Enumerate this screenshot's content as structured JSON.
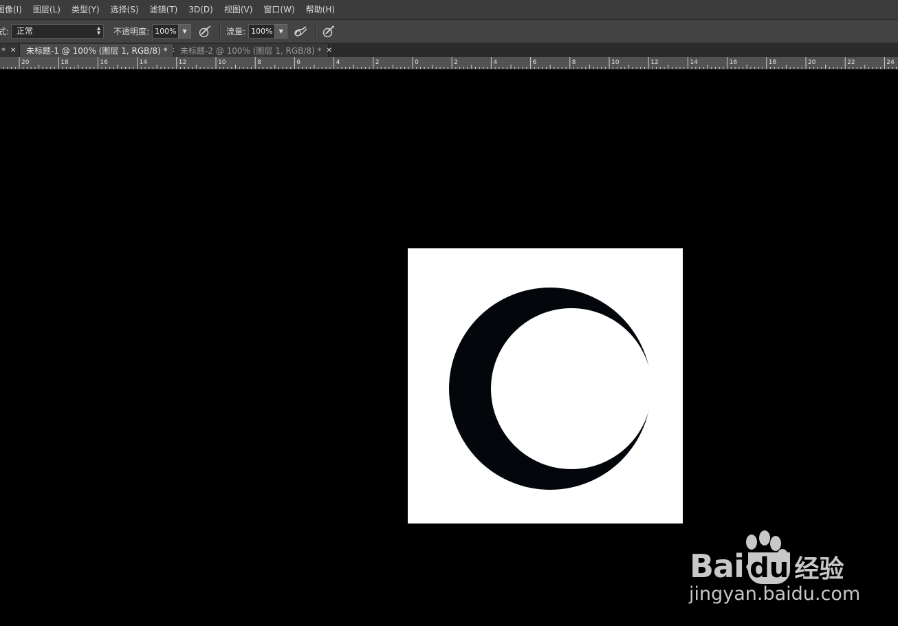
{
  "menu": {
    "items": [
      "图像(I)",
      "图层(L)",
      "类型(Y)",
      "选择(S)",
      "滤镜(T)",
      "3D(D)",
      "视图(V)",
      "窗口(W)",
      "帮助(H)"
    ]
  },
  "options": {
    "mode_label": "式:",
    "mode_value": "正常",
    "opacity_label": "不透明度:",
    "opacity_value": "100%",
    "flow_label": "流量:",
    "flow_value": "100%"
  },
  "tabs": [
    {
      "label": "*",
      "active": false
    },
    {
      "label": "未标题-1 @ 100% (图层 1, RGB/8) *",
      "active": true
    },
    {
      "label": "未标题-2 @ 100% (图层 1, RGB/8) *",
      "active": false
    }
  ],
  "ruler": {
    "labels": [
      "20",
      "18",
      "16",
      "14",
      "12",
      "10",
      "8",
      "6",
      "4",
      "2",
      "0",
      "2",
      "4",
      "6",
      "8",
      "10",
      "12",
      "14",
      "16",
      "18",
      "20",
      "22",
      "24"
    ]
  },
  "watermark": {
    "brand_left": "Bai",
    "brand_right": "du",
    "brand_cn": "经验",
    "url": "jingyan.baidu.com"
  },
  "colors": {
    "menubar": "#3c3c3c",
    "optionsbar": "#434343",
    "tab_active": "#4a4a4a",
    "canvas": "#000000",
    "document": "#ffffff",
    "crescent": "#03060b",
    "watermark": "#c8c8c8"
  }
}
